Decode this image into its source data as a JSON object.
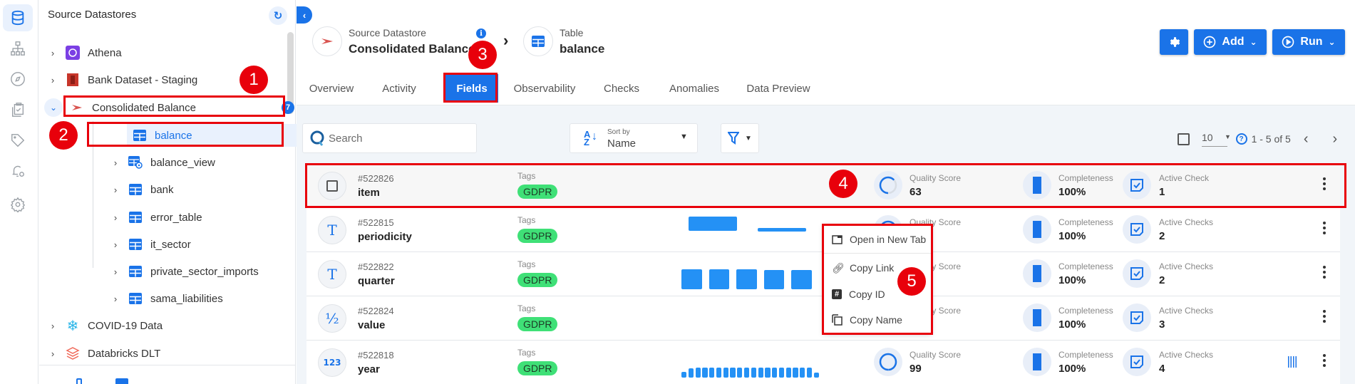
{
  "rail": {
    "items": [
      {
        "name": "datastores",
        "icon": "database-icon",
        "active": true
      },
      {
        "name": "hierarchy",
        "icon": "sitemap-icon"
      },
      {
        "name": "explore",
        "icon": "compass-icon"
      },
      {
        "name": "checks",
        "icon": "clipboard-check-icon"
      },
      {
        "name": "tags",
        "icon": "tag-icon"
      },
      {
        "name": "notifications",
        "icon": "bell-gear-icon"
      },
      {
        "name": "settings",
        "icon": "gear-icon"
      }
    ]
  },
  "sidebar": {
    "title": "Source Datastores",
    "refresh_icon": "refresh-icon",
    "datastores": [
      {
        "label": "Athena",
        "icon": "athena-icon",
        "expanded": false
      },
      {
        "label": "Bank Dataset - Staging",
        "icon": "s3-icon",
        "expanded": false
      },
      {
        "label": "Consolidated Balance",
        "icon": "sqlserver-icon",
        "expanded": true,
        "badge": "7",
        "action_icon": "search-icon"
      },
      {
        "label": "COVID-19 Data",
        "icon": "snowflake-icon",
        "expanded": false
      },
      {
        "label": "Databricks DLT",
        "icon": "databricks-icon",
        "expanded": false
      }
    ],
    "tables": [
      {
        "label": "balance",
        "icon": "table-icon",
        "selected": true
      },
      {
        "label": "balance_view",
        "icon": "view-icon"
      },
      {
        "label": "bank",
        "icon": "table-icon"
      },
      {
        "label": "error_table",
        "icon": "table-icon"
      },
      {
        "label": "it_sector",
        "icon": "table-icon"
      },
      {
        "label": "private_sector_imports",
        "icon": "table-icon"
      },
      {
        "label": "sama_liabilities",
        "icon": "table-icon"
      }
    ]
  },
  "annotations": [
    "1",
    "2",
    "3",
    "4",
    "5"
  ],
  "header": {
    "collapse_icon": "chevron-left-icon",
    "datastore_label": "Source Datastore",
    "datastore_name": "Consolidated Balance",
    "table_label": "Table",
    "table_name": "balance",
    "info_glyph": "i",
    "separator_glyph": "›",
    "settings_icon": "gear-icon",
    "add_label": "Add",
    "run_label": "Run"
  },
  "tabs": [
    {
      "label": "Overview"
    },
    {
      "label": "Activity"
    },
    {
      "label": "Fields",
      "active": true
    },
    {
      "label": "Observability"
    },
    {
      "label": "Checks"
    },
    {
      "label": "Anomalies"
    },
    {
      "label": "Data Preview"
    }
  ],
  "toolbar": {
    "search_placeholder": "Search",
    "sort_caption": "Sort by",
    "sort_value": "Name",
    "page_size": "10",
    "range": "1 - 5 of 5"
  },
  "fields": [
    {
      "id": "#522826",
      "name": "item",
      "type_icon": "checkbox-icon",
      "tags_label": "Tags",
      "tag": "GDPR",
      "quality_label": "Quality Score",
      "quality": "63",
      "completeness_label": "Completeness",
      "completeness": "100%",
      "checks_label": "Active Check",
      "checks": "1",
      "histogram": []
    },
    {
      "id": "#522815",
      "name": "periodicity",
      "type_icon": "text-type-icon",
      "type_glyph": "T",
      "tags_label": "Tags",
      "tag": "GDPR",
      "quality_label": "Quality Score",
      "quality": "",
      "completeness_label": "Completeness",
      "completeness": "100%",
      "checks_label": "Active Checks",
      "checks": "2",
      "histogram": [
        1.0,
        0.25
      ]
    },
    {
      "id": "#522822",
      "name": "quarter",
      "type_icon": "text-type-icon",
      "type_glyph": "T",
      "tags_label": "Tags",
      "tag": "GDPR",
      "quality_label": "Quality Score",
      "quality": "",
      "completeness_label": "Completeness",
      "completeness": "100%",
      "checks_label": "Active Checks",
      "checks": "2",
      "histogram": [
        1.0,
        1.0,
        1.0,
        0.95,
        0.95
      ]
    },
    {
      "id": "#522824",
      "name": "value",
      "type_icon": "fraction-type-icon",
      "type_glyph": "½",
      "tags_label": "Tags",
      "tag": "GDPR",
      "quality_label": "Quality Score",
      "quality": "",
      "completeness_label": "Completeness",
      "completeness": "100%",
      "checks_label": "Active Checks",
      "checks": "3",
      "histogram": []
    },
    {
      "id": "#522818",
      "name": "year",
      "type_icon": "number-type-icon",
      "type_glyph": "123",
      "tags_label": "Tags",
      "tag": "GDPR",
      "quality_label": "Quality Score",
      "quality": "99",
      "completeness_label": "Completeness",
      "completeness": "100%",
      "checks_label": "Active Checks",
      "checks": "4",
      "histogram": [
        0.6,
        0.9,
        1,
        1,
        1,
        1,
        1,
        1,
        1,
        1,
        1,
        1,
        1,
        1,
        1,
        1,
        1,
        1,
        1,
        0.5
      ]
    }
  ],
  "context_menu": {
    "items": [
      {
        "label": "Open in New Tab",
        "icon": "open-new-tab-icon"
      },
      {
        "label": "Copy Link",
        "icon": "link-icon"
      },
      {
        "label": "Copy ID",
        "icon": "hash-icon"
      },
      {
        "label": "Copy Name",
        "icon": "copy-icon"
      }
    ]
  },
  "colors": {
    "accent": "#1a73e8",
    "tag": "#3fe077",
    "annotation": "#e8000b"
  }
}
